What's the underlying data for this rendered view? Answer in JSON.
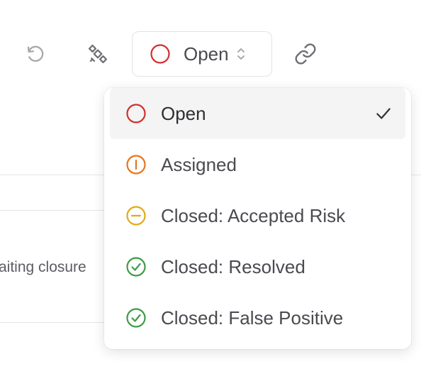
{
  "toolbar": {
    "undo_icon": "undo-icon",
    "satellite_icon": "satellite-icon",
    "link_icon": "link-icon",
    "status_select": {
      "value": "Open",
      "icon": "open-circle-icon",
      "caret": "chevron-up-down-icon"
    }
  },
  "background": {
    "row_text": "aiting closure"
  },
  "status_menu": {
    "items": [
      {
        "label": "Open",
        "icon": "open-circle-icon",
        "color": "#d32f2f",
        "selected": true
      },
      {
        "label": "Assigned",
        "icon": "assigned-icon",
        "color": "#e8741c",
        "selected": false
      },
      {
        "label": "Closed: Accepted Risk",
        "icon": "accepted-risk-icon",
        "color": "#e2aa16",
        "selected": false
      },
      {
        "label": "Closed: Resolved",
        "icon": "resolved-check-icon",
        "color": "#3d9b48",
        "selected": false
      },
      {
        "label": "Closed: False Positive",
        "icon": "false-positive-check-icon",
        "color": "#3d9b48",
        "selected": false
      }
    ],
    "checkmark_icon": "checkmark-icon"
  },
  "colors": {
    "open": "#d32f2f",
    "assigned": "#e8741c",
    "accepted_risk": "#e2aa16",
    "resolved": "#3d9b48",
    "icon_gray": "#8a8a90"
  }
}
